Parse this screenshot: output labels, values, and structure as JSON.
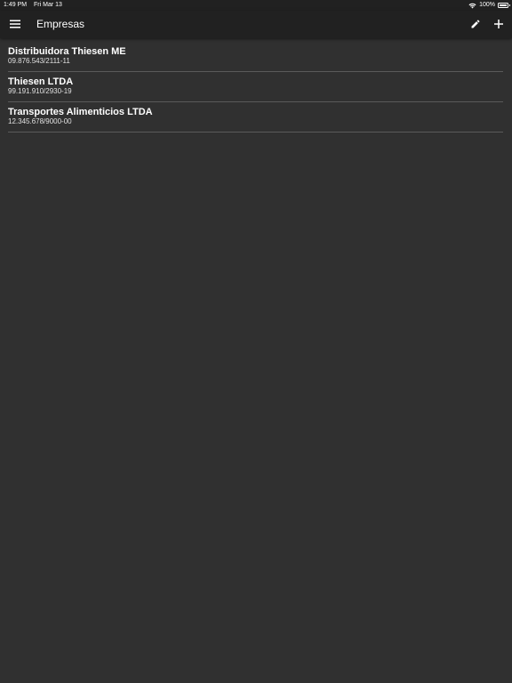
{
  "status_bar": {
    "time": "1:49 PM",
    "date": "Fri Mar 13",
    "battery": "100%"
  },
  "toolbar": {
    "title": "Empresas",
    "menu_icon": "hamburger-menu-icon",
    "edit_icon": "pencil-icon",
    "add_icon": "plus-icon"
  },
  "companies": [
    {
      "name": "Distribuidora Thiesen ME",
      "cnpj": "09.876.543/2111-11"
    },
    {
      "name": "Thiesen LTDA",
      "cnpj": "99.191.910/2930-19"
    },
    {
      "name": "Transportes Alimenticios LTDA",
      "cnpj": "12.345.678/9000-00"
    }
  ]
}
